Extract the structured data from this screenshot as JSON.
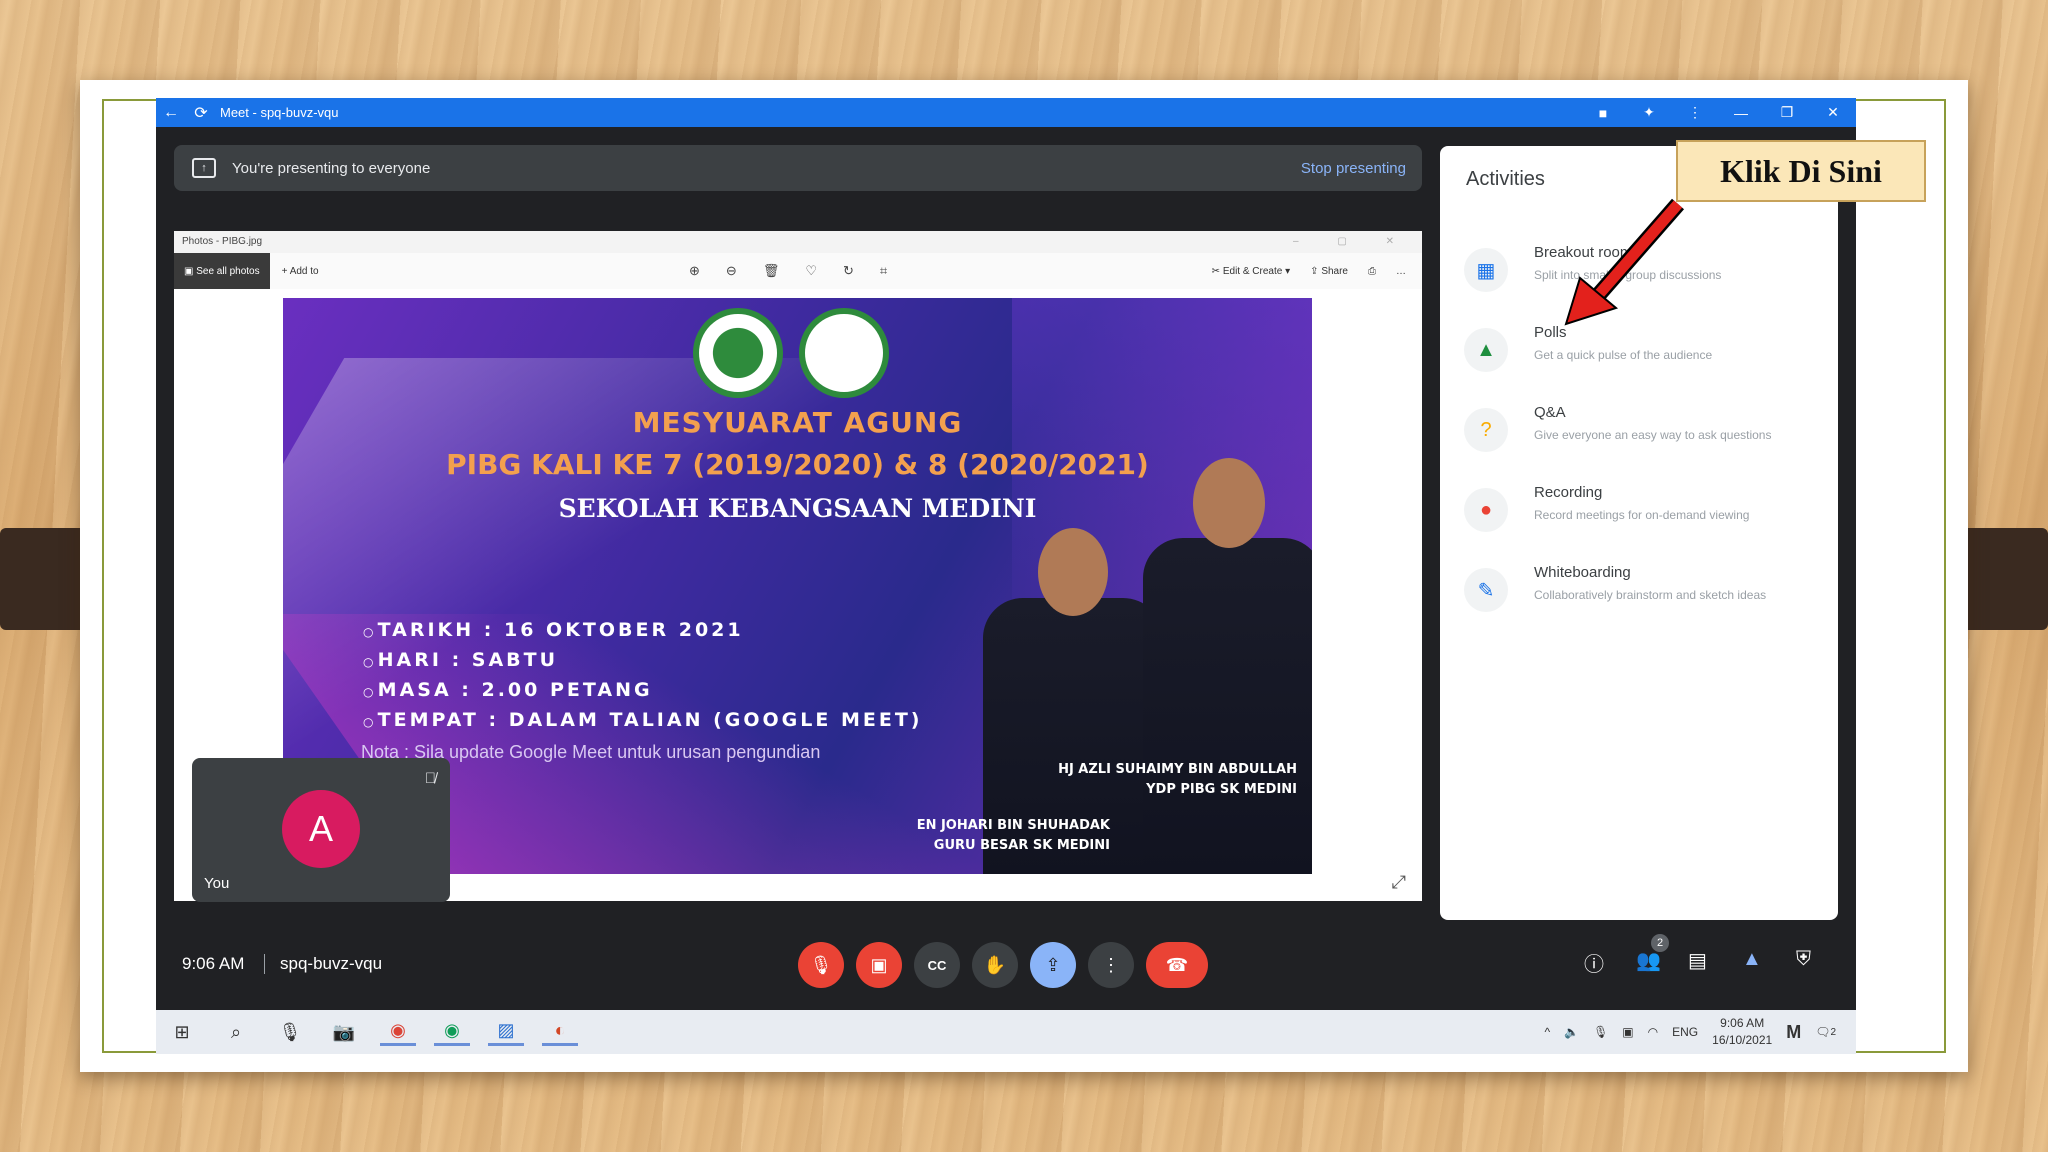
{
  "window": {
    "title": "Meet - spq-buvz-vqu"
  },
  "banner": {
    "text": "You're presenting to everyone",
    "stop_label": "Stop presenting"
  },
  "photos": {
    "title": "Photos - PIBG.jpg",
    "see_all": "See all photos",
    "add_to": "Add to",
    "edit_create": "Edit & Create",
    "share": "Share"
  },
  "poster": {
    "heading1": "MESYUARAT AGUNG",
    "heading2": "PIBG KALI KE  7 (2019/2020) & 8 (2020/2021)",
    "heading3": "SEKOLAH KEBANGSAAN MEDINI",
    "details": [
      "TARIKH : 16 OKTOBER 2021",
      "HARI : SABTU",
      "MASA : 2.00 PETANG",
      "TEMPAT : DALAM TALIAN (GOOGLE MEET)"
    ],
    "note": "Nota : Sila update Google Meet untuk urusan pengundian",
    "caption1_line1": "HJ AZLI SUHAIMY BIN ABDULLAH",
    "caption1_line2": "YDP PIBG SK MEDINI",
    "caption2_line1": "EN JOHARI BIN SHUHADAK",
    "caption2_line2": "GURU BESAR SK MEDINI"
  },
  "self_tile": {
    "initial": "A",
    "name": "You"
  },
  "activities": {
    "title": "Activities",
    "items": [
      {
        "name": "Breakout rooms",
        "desc": "Split into smaller group discussions",
        "icon": "breakout-icon",
        "color": "#1a73e8"
      },
      {
        "name": "Polls",
        "desc": "Get a quick pulse of the audience",
        "icon": "polls-icon",
        "color": "#1e8e3e"
      },
      {
        "name": "Q&A",
        "desc": "Give everyone an easy way to ask questions",
        "icon": "question-icon",
        "color": "#f9ab00"
      },
      {
        "name": "Recording",
        "desc": "Record meetings for on-demand viewing",
        "icon": "record-icon",
        "color": "#ea4335"
      },
      {
        "name": "Whiteboarding",
        "desc": "Collaboratively brainstorm and sketch ideas",
        "icon": "whiteboard-icon",
        "color": "#1a73e8"
      }
    ]
  },
  "bottom_bar": {
    "time": "9:06 AM",
    "meeting_code": "spq-buvz-vqu",
    "people_count": "2"
  },
  "taskbar": {
    "lang": "ENG",
    "time": "9:06 AM",
    "date": "16/10/2021",
    "notif_count": "2"
  },
  "annotation": {
    "callout": "Klik Di Sini"
  }
}
